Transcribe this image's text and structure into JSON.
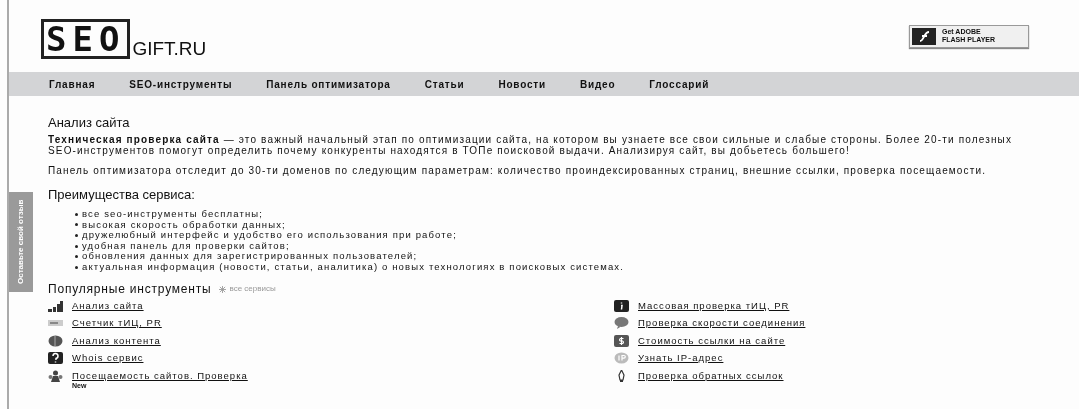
{
  "logo": {
    "mark": "SEO",
    "text": "GIFT.RU"
  },
  "flash_badge": {
    "line1": "Get ADOBE",
    "line2": "FLASH PLAYER"
  },
  "nav": [
    "Главная",
    "SEO-инструменты",
    "Панель оптимизатора",
    "Статьи",
    "Новости",
    "Видео",
    "Глоссарий"
  ],
  "feedback_tab": "Оставьте свой отзыв",
  "title": "Анализ сайта",
  "intro": "**Техническая проверка сайта** — это важный начальный этап по оптимизации сайта, на котором вы узнаете все свои сильные и слабые стороны. Более 20-ти полезных\nSEO-инструментов помогут определить почему конкуренты находятся в ТОПе поисковой выдачи. Анализируя сайт, вы добьетесь большего!",
  "panel_text": "Панель оптимизатора отследит до 30-ти доменов по следующим параметрам: количество проиндексированных страниц, внешние ссылки, проверка посещаемости.",
  "advantages": {
    "title": "Преимущества сервиса:",
    "items": [
      "все seo-инструменты бесплатны;",
      "высокая скорость обработки данных;",
      "дружелюбный интерфейс и удобство его использования при работе;",
      "удобная панель для проверки сайтов;",
      "обновления данных для зарегистрированных пользователей;",
      "актуальная информация (новости, статьи, аналитика) о новых технологиях в поисковых системах."
    ]
  },
  "tools": {
    "title": "Популярные инструменты",
    "all_link": "все сервисы",
    "columns": [
      [
        {
          "label": "Анализ сайта"
        },
        {
          "label": "Счетчик тИЦ, PR"
        },
        {
          "label": "Анализ контента"
        },
        {
          "label": "Whois сервис"
        },
        {
          "label": "Посещаемость сайтов. Проверка",
          "badge": "New"
        }
      ],
      [
        {
          "label": "Массовая проверка тИЦ, PR"
        },
        {
          "label": "Проверка скорости соединения"
        },
        {
          "label": "Стоимость ссылки на сайте"
        },
        {
          "label": "Узнать IP-адрес"
        },
        {
          "label": "Проверка обратных ссылок"
        }
      ]
    ]
  }
}
